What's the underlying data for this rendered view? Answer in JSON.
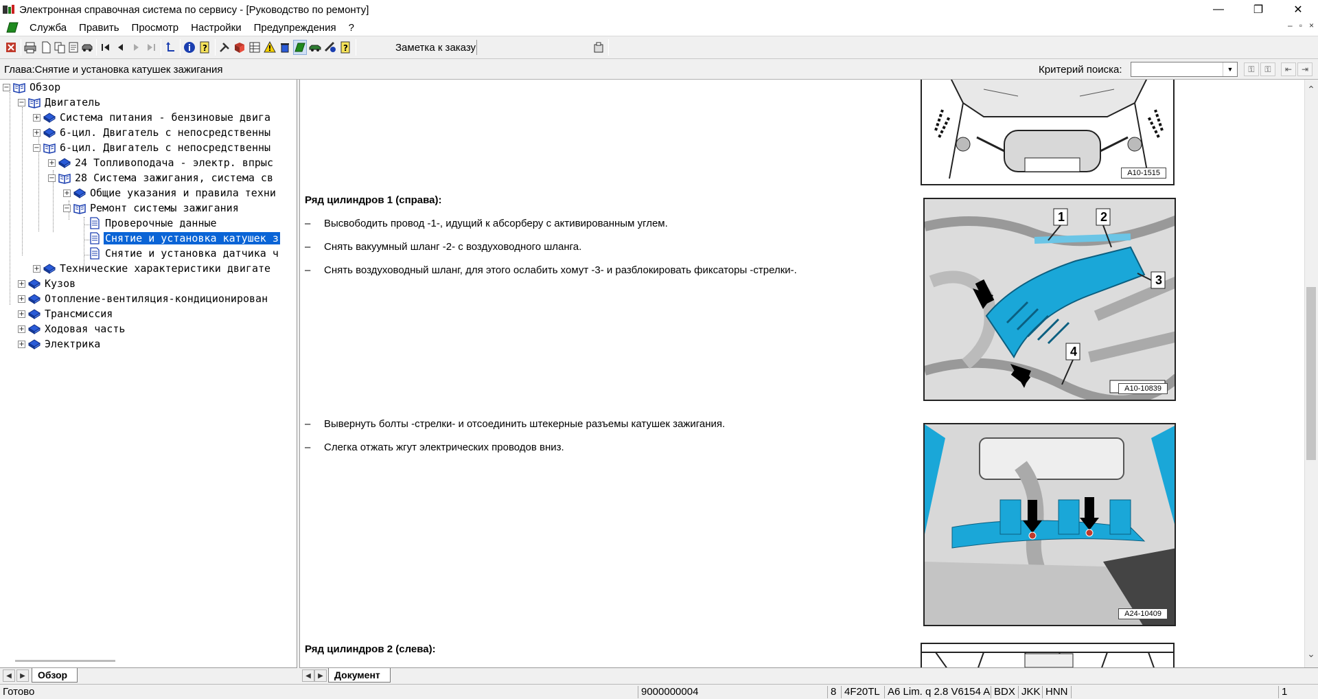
{
  "window": {
    "title": "Электронная справочная система по сервису - [Руководство по ремонту]",
    "minimize": "—",
    "restore": "❐",
    "close": "✕"
  },
  "menu": {
    "items": [
      "Служба",
      "Править",
      "Просмотр",
      "Настройки",
      "Предупреждения",
      "?"
    ],
    "mdi_minimize": "–",
    "mdi_restore": "▫",
    "mdi_close": "×"
  },
  "toolbar": {
    "note_label": "Заметка к заказу:",
    "note_value": ""
  },
  "infobar": {
    "chapter": "Глава:Снятие и установка катушек зажигания",
    "criteria_label": "Критерий  поиска:",
    "criteria_value": ""
  },
  "tree": {
    "nodes": [
      {
        "label": "Обзор",
        "expander": "−",
        "icon": "open-book-icon"
      },
      {
        "label": "Двигатель",
        "expander": "−",
        "icon": "open-book-icon"
      },
      {
        "label": "Система питания - бензиновые двига",
        "expander": "+",
        "icon": "closed-book-icon"
      },
      {
        "label": "6-цил. Двигатель с непосредственны",
        "expander": "+",
        "icon": "closed-book-icon"
      },
      {
        "label": "6-цил. Двигатель с непосредственны",
        "expander": "−",
        "icon": "open-book-icon"
      },
      {
        "label": "24 Топливоподача - электр. впрыс",
        "expander": "+",
        "icon": "closed-book-icon"
      },
      {
        "label": "28 Система зажигания, система св",
        "expander": "−",
        "icon": "open-book-icon"
      },
      {
        "label": "Общие указания и правила техни",
        "expander": "+",
        "icon": "closed-book-icon"
      },
      {
        "label": "Ремонт системы зажигания",
        "expander": "−",
        "icon": "open-book-icon"
      },
      {
        "label": "Проверочные данные",
        "expander": "",
        "icon": "document-icon"
      },
      {
        "label": "Снятие и установка катушек з",
        "expander": "",
        "icon": "document-icon"
      },
      {
        "label": "Снятие и установка датчика ч",
        "expander": "",
        "icon": "document-icon"
      },
      {
        "label": "Технические характеристики двигате",
        "expander": "+",
        "icon": "closed-book-icon"
      },
      {
        "label": "Кузов",
        "expander": "+",
        "icon": "closed-book-icon"
      },
      {
        "label": "Отопление-вентиляция-кондиционирован",
        "expander": "+",
        "icon": "closed-book-icon"
      },
      {
        "label": "Трансмиссия",
        "expander": "+",
        "icon": "closed-book-icon"
      },
      {
        "label": "Ходовая часть",
        "expander": "+",
        "icon": "closed-book-icon"
      },
      {
        "label": "Электрика",
        "expander": "+",
        "icon": "closed-book-icon"
      }
    ],
    "tab_label": "Обзор"
  },
  "document": {
    "heading_1": "Ряд цилиндров 1 (справа):",
    "steps_1": [
      "Высвободить провод -1-, идущий к абсорберу с активированным углем.",
      "Снять вакуумный шланг -2- с воздуховодного шланга.",
      "Снять воздуховодный шланг, для этого ослабить хомут -3- и разблокировать фиксаторы -стрелки-."
    ],
    "steps_2": [
      "Вывернуть болты -стрелки- и отсоединить штекерные разъемы катушек зажигания.",
      "Слегка отжать жгут электрических проводов вниз."
    ],
    "heading_2": "Ряд цилиндров 2 (слева):",
    "dash": "–",
    "figures": [
      {
        "code": "A10-1515"
      },
      {
        "code": "A10-10839",
        "callouts": [
          "1",
          "2",
          "3",
          "4"
        ]
      },
      {
        "code": "A24-10409"
      },
      {
        "code": ""
      }
    ],
    "tab_label": "Документ"
  },
  "status": {
    "text": "Готово",
    "order_number": "9000000004",
    "field_8": "8",
    "engine_code": "4F20TL",
    "model": "A6 Lim. q 2.8 V6154 A",
    "code_1": "BDX",
    "code_2": "JKK",
    "code_3": "HNN",
    "page": "1"
  },
  "colors": {
    "selection": "#0a64d6",
    "highlight_part": "#1aa7d8",
    "book_blue": "#1b3fb0"
  }
}
